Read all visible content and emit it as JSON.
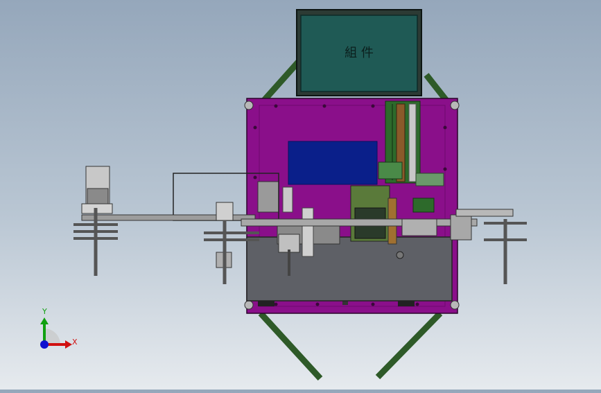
{
  "viewport": {
    "screen_label": "組 件",
    "triad": {
      "y_label": "Y",
      "x_label": "X"
    }
  },
  "colors": {
    "background_top": "#95a7bb",
    "background_bottom": "#e6eaee",
    "frame_purple": "#8a0f8a",
    "frame_green": "#2e5a28",
    "screen_teal": "#1f5a55",
    "panel_blue": "#0a1f8a",
    "base_gray": "#5e6066",
    "axis_x": "#d01010",
    "axis_y": "#10a010",
    "axis_z": "#1010d0"
  }
}
